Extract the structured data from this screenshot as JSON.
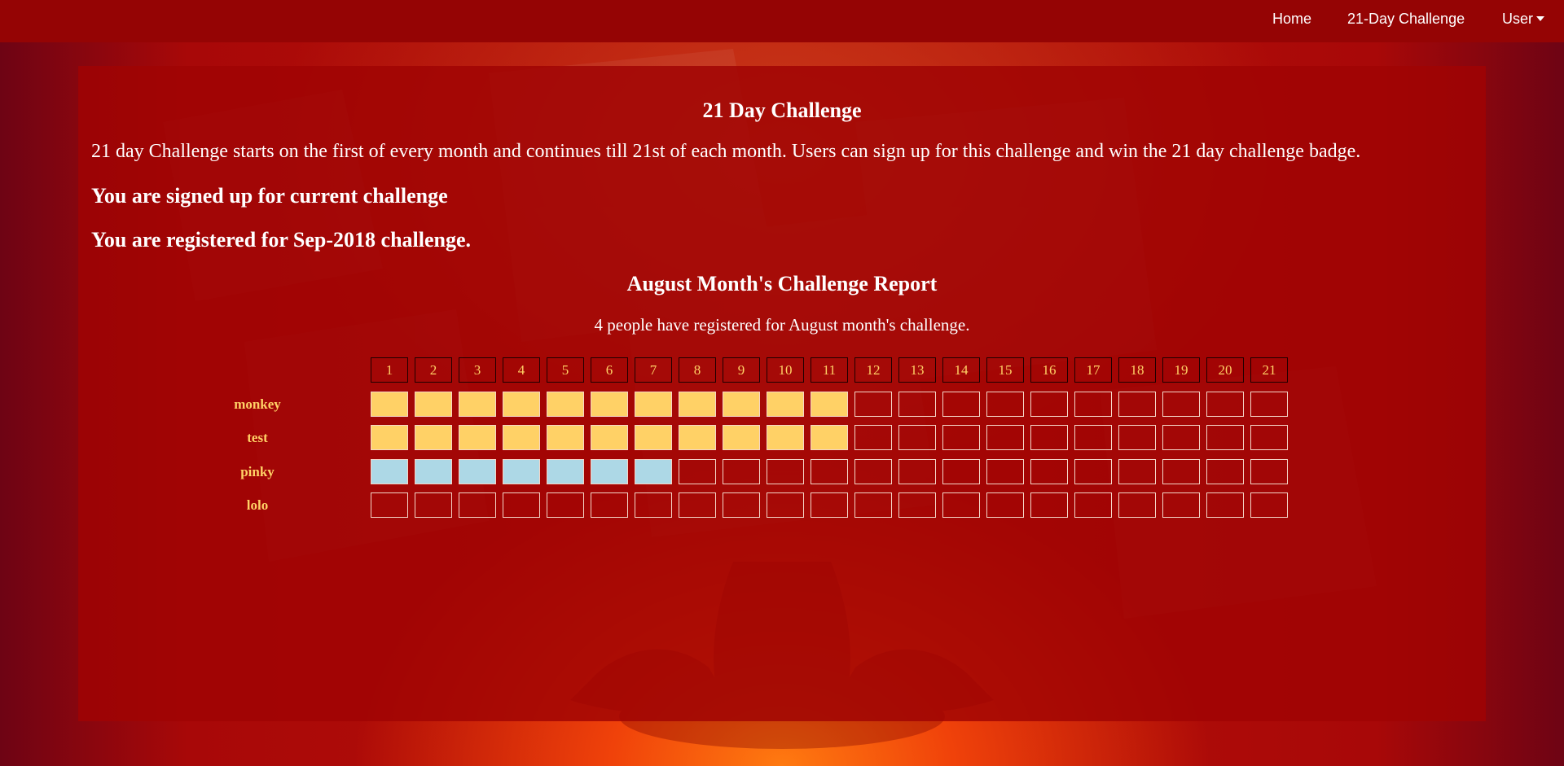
{
  "nav": {
    "home": "Home",
    "challenge": "21-Day Challenge",
    "user": "User"
  },
  "page": {
    "title": "21 Day Challenge",
    "description": "21 day Challenge starts on the first of every month and continues till 21st of each month. Users can sign up for this challenge and win the 21 day challenge badge.",
    "signed_up": "You are signed up for current challenge",
    "registered": "You are registered for Sep-2018 challenge."
  },
  "report": {
    "title": "August Month's Challenge Report",
    "count_text": "4 people have registered for August month's challenge.",
    "days": [
      "1",
      "2",
      "3",
      "4",
      "5",
      "6",
      "7",
      "8",
      "9",
      "10",
      "11",
      "12",
      "13",
      "14",
      "15",
      "16",
      "17",
      "18",
      "19",
      "20",
      "21"
    ],
    "users": [
      {
        "name": "monkey",
        "completed_days": 11,
        "color": "#ffd166"
      },
      {
        "name": "test",
        "completed_days": 11,
        "color": "#ffd166"
      },
      {
        "name": "pinky",
        "completed_days": 7,
        "color": "#add8e6"
      },
      {
        "name": "lolo",
        "completed_days": 0,
        "color": ""
      }
    ]
  },
  "colors": {
    "navbar": "#950404",
    "panel": "#a00404",
    "highlight_text": "#ffd166",
    "completed_yellow": "#ffd166",
    "completed_blue": "#add8e6"
  }
}
